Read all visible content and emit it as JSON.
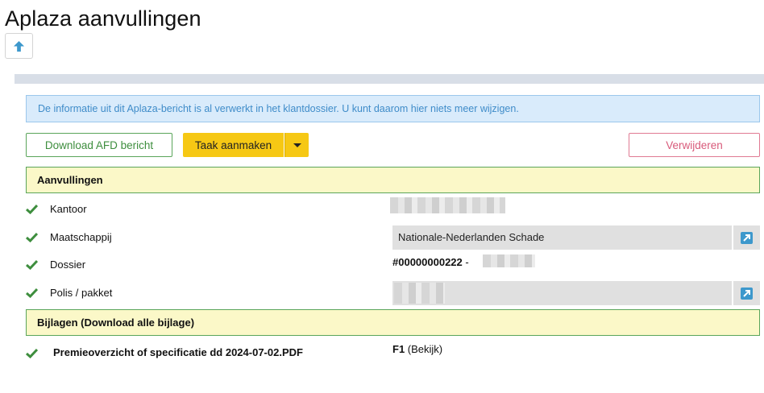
{
  "page": {
    "title": "Aplaza aanvullingen"
  },
  "toolbar": {
    "up_icon": "arrow-up-icon"
  },
  "alert": {
    "text": "De informatie uit dit Aplaza-bericht is al verwerkt in het klantdossier. U kunt daarom hier niets meer wijzigen."
  },
  "actions": {
    "download_label": "Download AFD bericht",
    "task_label": "Taak aanmaken",
    "delete_label": "Verwijderen"
  },
  "aanvullingen": {
    "header": "Aanvullingen",
    "rows": [
      {
        "label": "Kantoor",
        "value": ""
      },
      {
        "label": "Maatschappij",
        "value": "Nationale-Nederlanden Schade"
      },
      {
        "label": "Dossier",
        "value_bold": "#00000000222",
        "value_suffix": " -"
      },
      {
        "label": "Polis / pakket",
        "value": ""
      }
    ]
  },
  "bijlagen": {
    "header": "Bijlagen (Download alle bijlage)",
    "files": [
      {
        "name": "Premieoverzicht of specificatie dd 2024-07-02.PDF",
        "code": "F1",
        "action": " (Bekijk)"
      }
    ]
  },
  "colors": {
    "success": "#3e8e3e",
    "warning": "#f6c814",
    "danger": "#d85a7a",
    "info": "#3f8cc9",
    "section_bg": "#fbf8c8"
  }
}
